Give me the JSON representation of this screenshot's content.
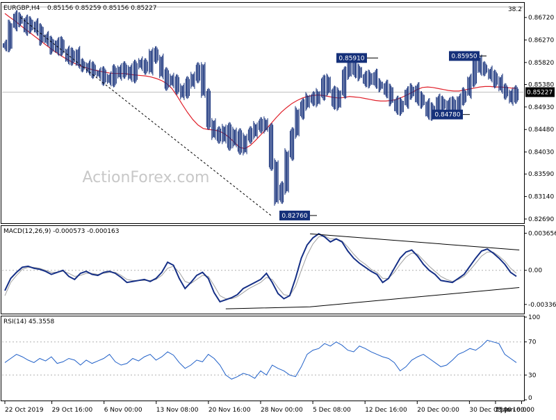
{
  "header": {
    "symbol": "EURGBP,H4",
    "ohlc": "0.85156 0.85259 0.85156 0.85227",
    "fib_level": "38.2",
    "watermark": "ActionForex.com"
  },
  "colors": {
    "bar": "#15307a",
    "ma": "#e0202a",
    "macd_line": "#152f86",
    "macd_signal": "#a0a0a0",
    "rsi": "#2060c8",
    "box_bg": "#15307a",
    "grid": "#b0b0b0"
  },
  "chart_data": [
    {
      "type": "candlestick",
      "pane": "price",
      "title": "EURGBP,H4",
      "ylim": [
        0.8262,
        0.87
      ],
      "y_ticks": [
        "0.86720",
        "0.86270",
        "0.85820",
        "0.85380",
        "0.84930",
        "0.84480",
        "0.84030",
        "0.83590",
        "0.83140",
        "0.82690"
      ],
      "y_tick_values": [
        0.8672,
        0.8627,
        0.8582,
        0.8538,
        0.8493,
        0.8448,
        0.8403,
        0.8359,
        0.8314,
        0.8269
      ],
      "current_price": "0.85227",
      "current_value": 0.85227,
      "annotations": [
        {
          "label": "0.85910",
          "value": 0.8591
        },
        {
          "label": "0.85950",
          "value": 0.8595
        },
        {
          "label": "0.84780",
          "value": 0.8478
        },
        {
          "label": "0.82760",
          "value": 0.8276
        }
      ],
      "series": [
        {
          "name": "price",
          "values": [
            0.8617,
            0.8655,
            0.8672,
            0.8665,
            0.865,
            0.866,
            0.8648,
            0.863,
            0.8625,
            0.861,
            0.862,
            0.8605,
            0.859,
            0.86,
            0.858,
            0.8575,
            0.857,
            0.856,
            0.8562,
            0.855,
            0.8545,
            0.8568,
            0.856,
            0.857,
            0.8555,
            0.8575,
            0.858,
            0.857,
            0.86,
            0.859,
            0.856,
            0.854,
            0.8548,
            0.853,
            0.852,
            0.854,
            0.8555,
            0.857,
            0.852,
            0.846,
            0.844,
            0.843,
            0.845,
            0.842,
            0.844,
            0.841,
            0.843,
            0.844,
            0.8455,
            0.846,
            0.845,
            0.8378,
            0.831,
            0.833,
            0.84,
            0.844,
            0.848,
            0.85,
            0.851,
            0.8505,
            0.852,
            0.8545,
            0.8525,
            0.85,
            0.852,
            0.856,
            0.858,
            0.8565,
            0.8555,
            0.8545,
            0.8555,
            0.854,
            0.8535,
            0.8525,
            0.8505,
            0.849,
            0.85,
            0.852,
            0.853,
            0.851,
            0.85,
            0.848,
            0.849,
            0.8505,
            0.8495,
            0.85,
            0.849,
            0.851,
            0.852,
            0.8545,
            0.8585,
            0.857,
            0.8565,
            0.8555,
            0.8545,
            0.853,
            0.852,
            0.851,
            0.8522
          ]
        },
        {
          "name": "ma",
          "values": [
            0.868,
            0.8672,
            0.8665,
            0.8656,
            0.8648,
            0.864,
            0.8632,
            0.8624,
            0.8616,
            0.8608,
            0.8601,
            0.8594,
            0.8588,
            0.8582,
            0.8577,
            0.8573,
            0.857,
            0.8567,
            0.8565,
            0.8563,
            0.8561,
            0.856,
            0.856,
            0.856,
            0.8558,
            0.8557,
            0.8556,
            0.8555,
            0.8553,
            0.855,
            0.8546,
            0.854,
            0.853,
            0.8515,
            0.8498,
            0.8482,
            0.8468,
            0.8457,
            0.845,
            0.8448,
            0.8447,
            0.8445,
            0.844,
            0.8432,
            0.8422,
            0.8412,
            0.841,
            0.8416,
            0.8426,
            0.8437,
            0.8448,
            0.846,
            0.8472,
            0.8483,
            0.8492,
            0.85,
            0.8506,
            0.8511,
            0.8514,
            0.8516,
            0.8517,
            0.8516,
            0.8514,
            0.8512,
            0.8511,
            0.8512,
            0.8514,
            0.8513,
            0.8512,
            0.851,
            0.8508,
            0.8506,
            0.8505,
            0.8505,
            0.8506,
            0.8508,
            0.8512,
            0.8517,
            0.8522,
            0.8528,
            0.8532,
            0.8533,
            0.8532,
            0.853,
            0.8528,
            0.8526,
            0.8525,
            0.8525,
            0.8527,
            0.8529,
            0.8531,
            0.8533,
            0.8534,
            0.8534,
            0.8533,
            0.8533,
            0.8532,
            0.8531,
            0.853
          ]
        }
      ]
    },
    {
      "type": "line",
      "pane": "macd",
      "title": "MACD(12,26,9) -0.000573 -0.000163",
      "ylim": [
        -0.0042,
        0.0043
      ],
      "y_ticks": [
        "0.003656",
        "0.00",
        "-0.003364"
      ],
      "y_tick_values": [
        0.003656,
        0.0,
        -0.003364
      ],
      "series": [
        {
          "name": "MACD",
          "values": [
            -0.002,
            -0.0008,
            -0.0002,
            0.0003,
            0.0004,
            0.0002,
            0.0001,
            -0.0001,
            -0.0004,
            -0.0002,
            0.0,
            -0.0006,
            -0.0009,
            -0.0003,
            -0.0001,
            -0.0004,
            -0.0005,
            -0.0002,
            -0.0001,
            -0.0003,
            -0.0007,
            -0.0012,
            -0.0011,
            -0.001,
            -0.0009,
            -0.0011,
            -0.0008,
            -0.0002,
            0.0008,
            0.0005,
            -0.0008,
            -0.0018,
            -0.0012,
            -0.0005,
            -0.0002,
            -0.0008,
            -0.0022,
            -0.0031,
            -0.0029,
            -0.0027,
            -0.0024,
            -0.0018,
            -0.0015,
            -0.0012,
            -0.0009,
            -0.0003,
            -0.0012,
            -0.0023,
            -0.0028,
            -0.0025,
            -0.0008,
            0.0012,
            0.0025,
            0.0032,
            0.0036,
            0.0033,
            0.0028,
            0.0031,
            0.0028,
            0.0019,
            0.0012,
            0.0007,
            0.0003,
            -0.0001,
            -0.0004,
            -0.0012,
            -0.0008,
            0.0002,
            0.0012,
            0.0018,
            0.002,
            0.0014,
            0.0006,
            0.0,
            -0.0004,
            -0.001,
            -0.0011,
            -0.0012,
            -0.0008,
            -0.0004,
            0.0004,
            0.0012,
            0.0019,
            0.0021,
            0.0017,
            0.0012,
            0.0006,
            -0.0002,
            -0.0006
          ]
        },
        {
          "name": "Signal",
          "values": [
            -0.0025,
            -0.0012,
            -0.0005,
            0.0001,
            0.0003,
            0.0003,
            0.0002,
            0.0,
            -0.0002,
            -0.0002,
            -0.0001,
            -0.0003,
            -0.0006,
            -0.0005,
            -0.0003,
            -0.0003,
            -0.0004,
            -0.0003,
            -0.0002,
            -0.0002,
            -0.0005,
            -0.0009,
            -0.001,
            -0.001,
            -0.001,
            -0.001,
            -0.0009,
            -0.0005,
            0.0002,
            0.0004,
            -0.0002,
            -0.0011,
            -0.0013,
            -0.0009,
            -0.0005,
            -0.0006,
            -0.0015,
            -0.0025,
            -0.0028,
            -0.0028,
            -0.0026,
            -0.0022,
            -0.0018,
            -0.0015,
            -0.0012,
            -0.0007,
            -0.0009,
            -0.0017,
            -0.0024,
            -0.0025,
            -0.0016,
            0.0,
            0.0015,
            0.0026,
            0.0033,
            0.0034,
            0.0031,
            0.0031,
            0.0029,
            0.0023,
            0.0016,
            0.001,
            0.0006,
            0.0001,
            -0.0002,
            -0.0008,
            -0.0008,
            -0.0002,
            0.0006,
            0.0013,
            0.0017,
            0.0016,
            0.001,
            0.0004,
            -0.0001,
            -0.0006,
            -0.0009,
            -0.0011,
            -0.0009,
            -0.0006,
            0.0,
            0.0007,
            0.0014,
            0.0018,
            0.0018,
            0.0014,
            0.0009,
            0.0002,
            -0.0003
          ]
        }
      ],
      "trendlines": [
        {
          "x": [
            52.5,
            88.5
          ],
          "y": [
            0.0036,
            0.002
          ]
        },
        {
          "x": [
            38,
            52.5,
            88.5
          ],
          "y": [
            -0.0038,
            -0.0036,
            -0.0017
          ]
        }
      ]
    },
    {
      "type": "line",
      "pane": "rsi",
      "title": "RSI(14) 45.3558",
      "ylim": [
        0,
        100
      ],
      "y_ticks": [
        "100",
        "70",
        "30",
        "0"
      ],
      "y_tick_values": [
        100,
        70,
        30,
        0
      ],
      "levels": [
        70,
        30
      ],
      "series": [
        {
          "name": "RSI",
          "values": [
            45,
            50,
            55,
            52,
            48,
            45,
            50,
            47,
            52,
            44,
            46,
            50,
            48,
            42,
            48,
            44,
            47,
            50,
            55,
            46,
            42,
            44,
            50,
            47,
            52,
            55,
            48,
            52,
            58,
            54,
            45,
            38,
            42,
            48,
            46,
            55,
            50,
            42,
            30,
            25,
            28,
            32,
            30,
            26,
            35,
            30,
            42,
            38,
            35,
            30,
            28,
            40,
            55,
            60,
            62,
            68,
            65,
            70,
            66,
            60,
            58,
            65,
            62,
            58,
            55,
            52,
            50,
            45,
            35,
            40,
            48,
            52,
            55,
            50,
            45,
            40,
            42,
            48,
            55,
            58,
            62,
            60,
            65,
            72,
            70,
            68,
            55,
            50,
            45
          ]
        }
      ]
    }
  ],
  "x_axis": {
    "labels": [
      "22 Oct 2019",
      "29 Oct 16:00",
      "6 Nov 00:00",
      "13 Nov 08:00",
      "20 Nov 16:00",
      "28 Nov 00:00",
      "5 Dec 08:00",
      "12 Dec 16:00",
      "20 Dec 00:00",
      "30 Dec 08:00",
      "7 Jan 16:00",
      "15 Jan 00:00"
    ],
    "label_index": [
      0,
      9,
      19,
      29,
      39,
      49,
      59,
      69,
      79,
      89,
      94,
      99
    ]
  }
}
